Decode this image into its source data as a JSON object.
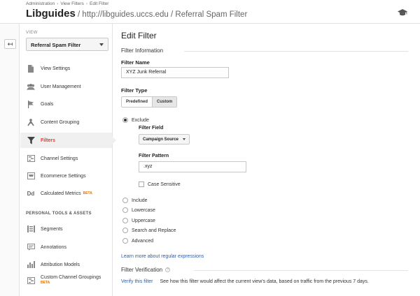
{
  "header": {
    "breadcrumbs": [
      "Administration",
      "View Filters",
      "Edit Filter"
    ],
    "title_name": "Libguides",
    "title_path": " / http://libguides.uccs.edu / Referral Spam Filter"
  },
  "sidebar": {
    "view_label": "VIEW",
    "view_select": "Referral Spam Filter",
    "items": [
      {
        "label": "View Settings",
        "icon": "document-icon"
      },
      {
        "label": "User Management",
        "icon": "users-icon"
      },
      {
        "label": "Goals",
        "icon": "flag-icon"
      },
      {
        "label": "Content Grouping",
        "icon": "person-icon"
      },
      {
        "label": "Filters",
        "icon": "filter-icon",
        "active": true
      },
      {
        "label": "Channel Settings",
        "icon": "channel-icon"
      },
      {
        "label": "Ecommerce Settings",
        "icon": "cart-icon"
      },
      {
        "label": "Calculated Metrics",
        "icon": "dd-icon",
        "badge": "BETA"
      }
    ],
    "section_label": "PERSONAL TOOLS & ASSETS",
    "tools": [
      {
        "label": "Segments",
        "icon": "segments-icon"
      },
      {
        "label": "Annotations",
        "icon": "annotation-icon"
      },
      {
        "label": "Attribution Models",
        "icon": "bar-chart-icon"
      },
      {
        "label": "Custom Channel Groupings",
        "icon": "channel-icon",
        "badge": "BETA"
      }
    ]
  },
  "main": {
    "page_title": "Edit Filter",
    "filter_info_heading": "Filter Information",
    "filter_name_label": "Filter Name",
    "filter_name_value": "XYZ Junk Referral",
    "filter_type_label": "Filter Type",
    "type_options": [
      "Predefined",
      "Custom"
    ],
    "exclude_label": "Exclude",
    "filter_field_label": "Filter Field",
    "filter_field_value": "Campaign Source",
    "filter_pattern_label": "Filter Pattern",
    "filter_pattern_value": ".xyz",
    "case_sensitive_label": "Case Sensitive",
    "other_options": [
      "Include",
      "Lowercase",
      "Uppercase",
      "Search and Replace",
      "Advanced"
    ],
    "regex_link": "Learn more about regular expressions",
    "verification_heading": "Filter Verification",
    "help_glyph": "?",
    "verify_link": "Verify this filter",
    "verify_desc": "See how this filter would affect the current view's data, based on traffic from the previous 7 days."
  },
  "icons": {
    "back": "↤",
    "graduation": "graduation-cap-icon"
  }
}
